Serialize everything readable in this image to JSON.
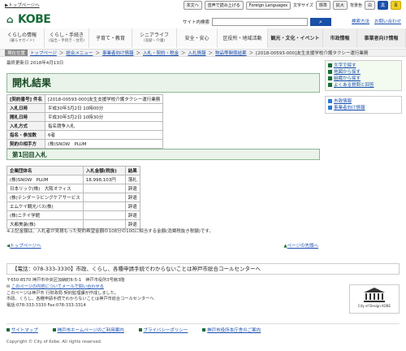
{
  "topbar": {
    "back_link": "▶トップページへ",
    "items": [
      "本文へ",
      "音声で読み上げる",
      "Foreign Languages",
      "文字サイズ",
      "標準",
      "拡大",
      "背景色",
      "白",
      "黒",
      "青"
    ]
  },
  "header": {
    "logo_text": "KOBE",
    "search_label": "サイト内検索",
    "search_placeholder": "",
    "links": [
      "検索方法",
      "お問い合わせ"
    ]
  },
  "nav": [
    {
      "label": "くらしの情報",
      "sub": "(暮らすガイド)"
    },
    {
      "label": "くらし・手続き",
      "sub": "(届出・手続き・住宅)"
    },
    {
      "label": "子育て・教育",
      "sub": ""
    },
    {
      "label": "シニアライフ",
      "sub": "(高齢・介護)"
    },
    {
      "label": "安全・安心",
      "sub": ""
    },
    {
      "label": "区役所・地域活動",
      "sub": ""
    },
    {
      "label": "観光・文化・イベント",
      "sub": ""
    },
    {
      "label": "市政情報",
      "sub": ""
    },
    {
      "label": "事業者向け情報",
      "sub": ""
    }
  ],
  "breadcrumb": {
    "tag": "現在位置",
    "items": [
      "トップページ",
      "総合メニュー",
      "事業者向け情報",
      "入札・契約・税金",
      "入札情報",
      "物品等関係結果",
      "[2018-00593-000]友生支援学校介護タクシー運行業務"
    ]
  },
  "updated": "最終更新日 2018年4月13日",
  "page_title": "開札結果",
  "info_table": [
    [
      "[契約番号] 件名",
      "[2018-00593-000]友生支援学校介護タクシー運行業務"
    ],
    [
      "入札日時",
      "平成30年3月2日 10時00分"
    ],
    [
      "開札日時",
      "平成30年3月2日 10時30分"
    ],
    [
      "入札方式",
      "指名競争入札"
    ],
    [
      "指名・参加数",
      "6者"
    ],
    [
      "契約の相手方",
      "(株)SNOW　PLUM"
    ]
  ],
  "round_title": "第1回目入札",
  "bid_table": {
    "headers": [
      "企業団体名",
      "入札金額(税抜)",
      "結果"
    ],
    "rows": [
      [
        "(株)SNOW　PLUM",
        "18,998,103円",
        "落札"
      ],
      [
        "日本リック(株)　大阪オフィス",
        "",
        "辞退"
      ],
      [
        "(株)テンダーラビングケアサービス",
        "",
        "辞退"
      ],
      [
        "エムケイ観光バス(株)",
        "",
        "辞退"
      ],
      [
        "(株)ニチイ学館",
        "",
        "辞退"
      ],
      [
        "大都美装(株)",
        "",
        "辞退"
      ]
    ]
  },
  "note": "※上記金額は、入札者が見積もった契約希望金額の108分の100に相当する金額(消費税抜き税額)です。",
  "page_links": {
    "top": "トップページへ",
    "back": "ページの先頭へ"
  },
  "sidebar": [
    {
      "label": "文字で探す",
      "color": "#1a6c3a"
    },
    {
      "label": "地図から探す",
      "color": "#1a6c3a"
    },
    {
      "label": "組織から探す",
      "color": "#1a6c3a"
    },
    {
      "label": "よくある質問と回答",
      "color": "#1a6c3a"
    },
    {
      "label": "市政情報",
      "color": "#2a7ad0"
    },
    {
      "label": "事業者向け情報",
      "color": "#2a7ad0"
    }
  ],
  "callcenter": "【電話：078-333-3330】市政、くらし、各種申請手続でわからないことは神戸市総合コールセンターへ",
  "footer": {
    "lines": [
      "〒650-8570 神戸市中央区加納町6-5-1　神戸市役所3号館3階",
      "このページの内容についてメールで問い合わせる",
      "このページは神戸市 行財政局 契約監理課が作成しました。",
      "市政、くらし、各種申請手続でわからないことは神戸市総合コールセンターへ",
      "電話:078-333-3330 Fax:078-333-3314"
    ],
    "seal_text": "City of Design KOBE",
    "links": [
      "サイトマップ",
      "神戸市ホームページのご利用案内",
      "プライバシーポリシー",
      "神戸市役所本庁舎のご案内"
    ],
    "copyright": "Copyright © City of Kobe. All rights reserved."
  }
}
